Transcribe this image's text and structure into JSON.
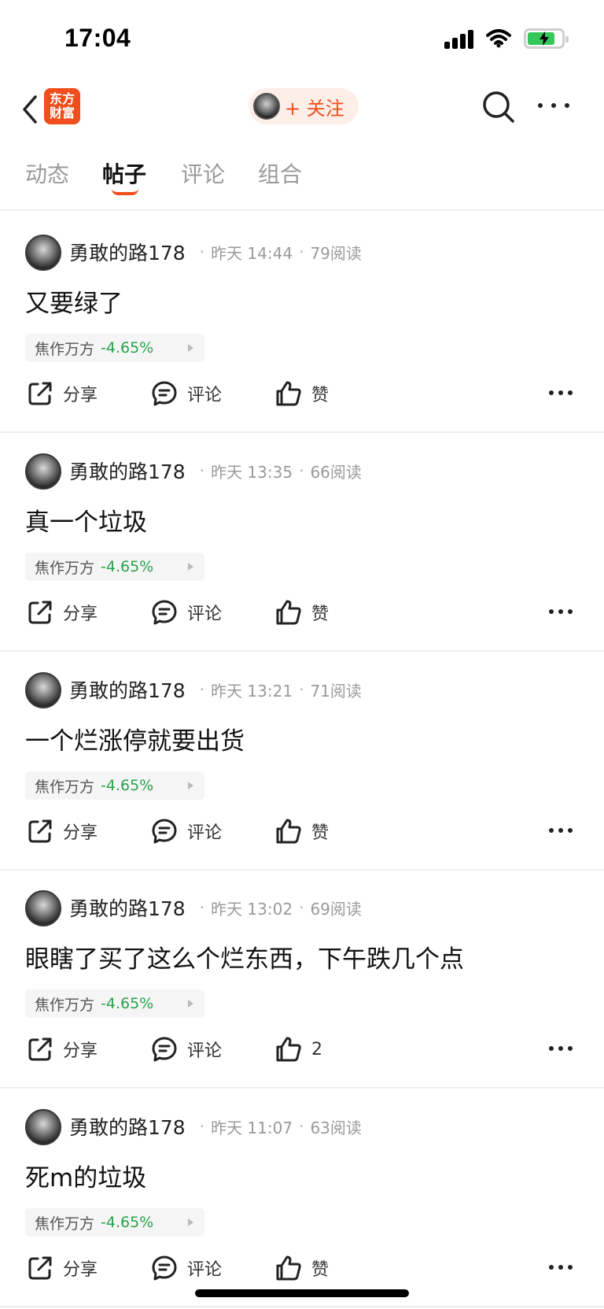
{
  "status_bar": {
    "time": "17:04"
  },
  "nav": {
    "logo_text": "东方财富",
    "follow_label": "+ 关注"
  },
  "tabs": [
    {
      "label": "动态",
      "active": false
    },
    {
      "label": "帖子",
      "active": true
    },
    {
      "label": "评论",
      "active": false
    },
    {
      "label": "组合",
      "active": false
    }
  ],
  "posts": [
    {
      "author": "勇敢的路178",
      "time": "昨天 14:44",
      "reads": "79阅读",
      "content": "又要绿了",
      "stock_name": "焦作万方",
      "stock_change": "-4.65%",
      "share_label": "分享",
      "comment_label": "评论",
      "like_label": "赞"
    },
    {
      "author": "勇敢的路178",
      "time": "昨天 13:35",
      "reads": "66阅读",
      "content": "真一个垃圾",
      "stock_name": "焦作万方",
      "stock_change": "-4.65%",
      "share_label": "分享",
      "comment_label": "评论",
      "like_label": "赞"
    },
    {
      "author": "勇敢的路178",
      "time": "昨天 13:21",
      "reads": "71阅读",
      "content": "一个烂涨停就要出货",
      "stock_name": "焦作万方",
      "stock_change": "-4.65%",
      "share_label": "分享",
      "comment_label": "评论",
      "like_label": "赞"
    },
    {
      "author": "勇敢的路178",
      "time": "昨天 13:02",
      "reads": "69阅读",
      "content": "眼瞎了买了这么个烂东西，下午跌几个点",
      "stock_name": "焦作万方",
      "stock_change": "-4.65%",
      "share_label": "分享",
      "comment_label": "评论",
      "like_label": "2"
    },
    {
      "author": "勇敢的路178",
      "time": "昨天 11:07",
      "reads": "63阅读",
      "content": "死m的垃圾",
      "stock_name": "焦作万方",
      "stock_change": "-4.65%",
      "share_label": "分享",
      "comment_label": "评论",
      "like_label": "赞"
    }
  ],
  "colors": {
    "accent": "#f04e1d",
    "stock_down": "#27a34a",
    "battery": "#34c759"
  }
}
